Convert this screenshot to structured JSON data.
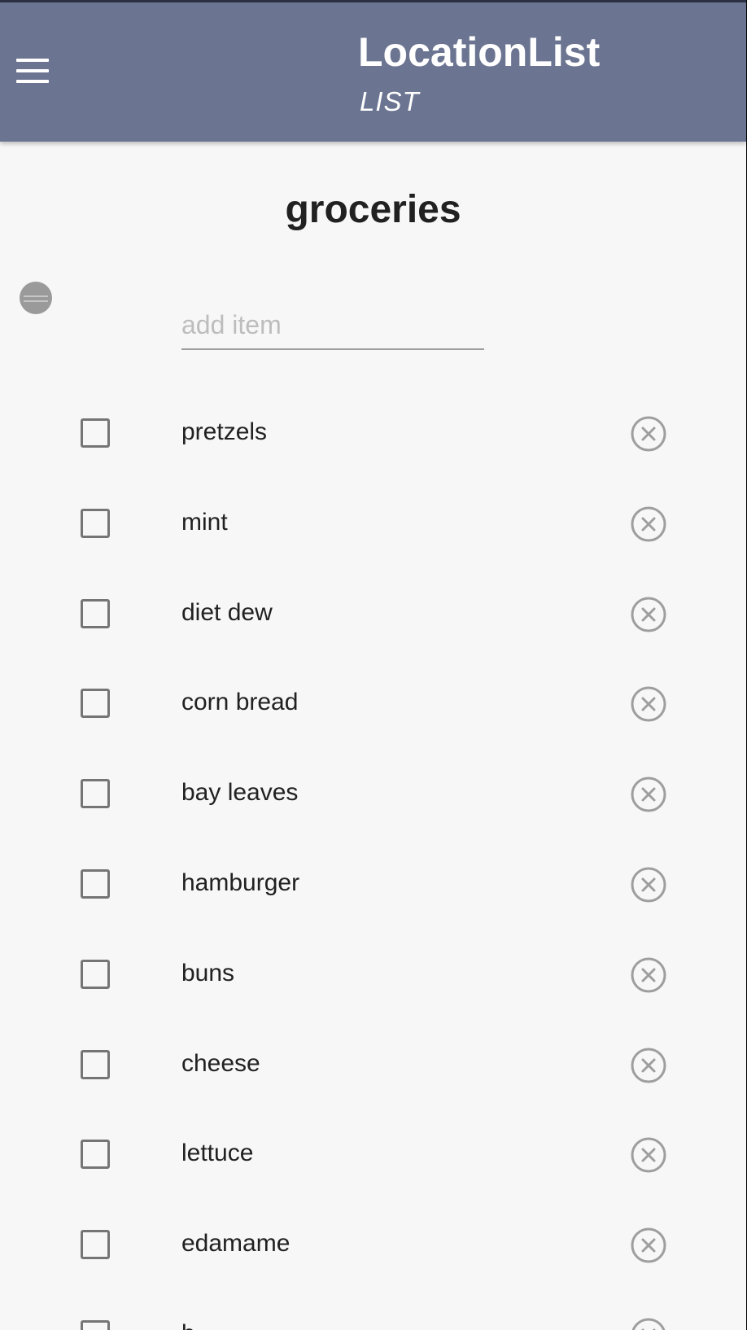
{
  "appbar": {
    "title": "LocationList",
    "subtitle": "LIST",
    "menu_icon": "menu-icon",
    "color": "#6b7591"
  },
  "list": {
    "title": "groceries",
    "add_placeholder": "add item",
    "add_value": "",
    "items": [
      {
        "label": "pretzels",
        "checked": false
      },
      {
        "label": "mint",
        "checked": false
      },
      {
        "label": "diet dew",
        "checked": false
      },
      {
        "label": "corn bread",
        "checked": false
      },
      {
        "label": "bay leaves",
        "checked": false
      },
      {
        "label": "hamburger",
        "checked": false
      },
      {
        "label": "buns",
        "checked": false
      },
      {
        "label": "cheese",
        "checked": false
      },
      {
        "label": "lettuce",
        "checked": false
      },
      {
        "label": "edamame",
        "checked": false
      },
      {
        "label": "b",
        "checked": false
      }
    ],
    "remove_icon": "close-circle-icon"
  }
}
